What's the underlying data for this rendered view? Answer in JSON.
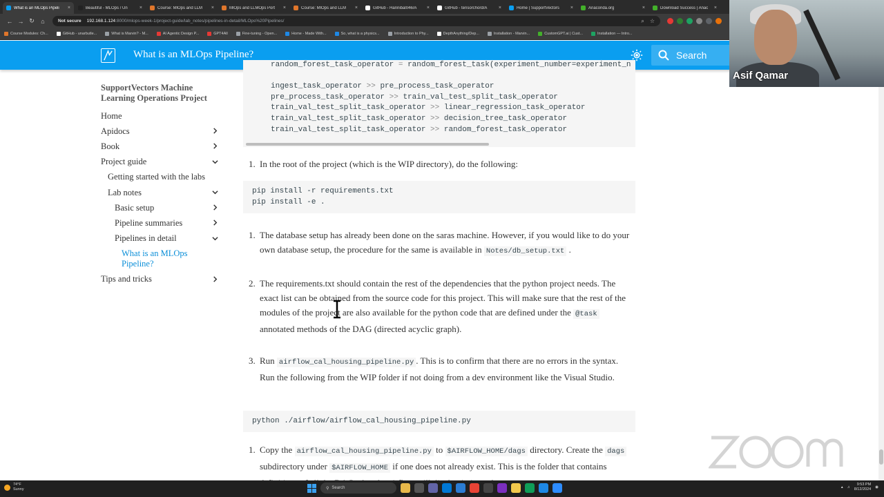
{
  "browser": {
    "tabs": [
      {
        "label": "What is an MLOps Pipeli",
        "color": "#0a9ef0",
        "active": true
      },
      {
        "label": "Beautiful - MLOps / Un",
        "color": "#222222"
      },
      {
        "label": "Course: MlOps and LLM",
        "color": "#e0762b"
      },
      {
        "label": "MlOps and LLMOps Port",
        "color": "#e0762b"
      },
      {
        "label": "Course: MlOps and LLM",
        "color": "#e0762b"
      },
      {
        "label": "GitHub - Hannibal046/A",
        "color": "#ffffff"
      },
      {
        "label": "GitHub - tensorchord/A",
        "color": "#ffffff"
      },
      {
        "label": "Home | SupportVectors",
        "color": "#0a9ef0"
      },
      {
        "label": "Anaconda.org",
        "color": "#43b02a"
      },
      {
        "label": "Download Success | Anac",
        "color": "#43b02a"
      }
    ],
    "security": "Not secure",
    "url_host": "192.168.1.124",
    "url_path": ":8000/mlops-week-1/project-guide/lab_notes/pipelines-in-detail/MLOps%20Pipelines/",
    "bookmarks": [
      "Course Modules: Ch...",
      "GitHub - unarbutle...",
      "What is Marvin? - M...",
      "AI Agentic Design P...",
      "GPT4All",
      "Fine-tuning - Open...",
      "Home - Made With...",
      "So, what is a physics...",
      "Introduction to Phy...",
      "DepthAnything/Dep...",
      "Installation - Marvin...",
      "CustomGPT.ai | Cust...",
      "Installation — Intro..."
    ]
  },
  "header": {
    "title": "What is an MLOps Pipeline?",
    "search_placeholder": "Search"
  },
  "sidebar": {
    "title": "SupportVectors Machine Learning Operations Project",
    "items": [
      {
        "label": "Home",
        "level": 0,
        "chevron": "none"
      },
      {
        "label": "Apidocs",
        "level": 0,
        "chevron": "right"
      },
      {
        "label": "Book",
        "level": 0,
        "chevron": "right"
      },
      {
        "label": "Project guide",
        "level": 0,
        "chevron": "down"
      },
      {
        "label": "Getting started with the labs",
        "level": 1,
        "chevron": "none"
      },
      {
        "label": "Lab notes",
        "level": 1,
        "chevron": "down"
      },
      {
        "label": "Basic setup",
        "level": 2,
        "chevron": "right"
      },
      {
        "label": "Pipeline summaries",
        "level": 2,
        "chevron": "right"
      },
      {
        "label": "Pipelines in detail",
        "level": 2,
        "chevron": "down"
      },
      {
        "label": "What is an MLOps Pipeline?",
        "level": 3,
        "chevron": "none"
      },
      {
        "label": "Tips and tricks",
        "level": 0,
        "chevron": "right"
      }
    ]
  },
  "content": {
    "code1_lines": [
      {
        "a": "random_forest_task_operator",
        "op": "=",
        "b": "random_forest_task(experiment_number=experiment_n"
      },
      {
        "a": "",
        "op": "",
        "b": ""
      },
      {
        "a": "ingest_task_operator",
        "op": ">>",
        "b": "pre_process_task_operator"
      },
      {
        "a": "pre_process_task_operator",
        "op": ">>",
        "b": "train_val_test_split_task_operator"
      },
      {
        "a": "train_val_test_split_task_operator",
        "op": ">>",
        "b": "linear_regression_task_operator"
      },
      {
        "a": "train_val_test_split_task_operator",
        "op": ">>",
        "b": "decision_tree_task_operator"
      },
      {
        "a": "train_val_test_split_task_operator",
        "op": ">>",
        "b": "random_forest_task_operator"
      }
    ],
    "step1": "In the root of the project (which is the WIP directory), do the following:",
    "code2_line1": "pip install -r requirements.txt",
    "code2_line2": "pip install -e .",
    "db_text": "The database setup has already been done on the saras machine. However, if you would like to do your own database setup, the procedure for the same is available in",
    "db_code": "Notes/db_setup.txt",
    "req_text1": "The requirements.txt should contain the rest of the dependencies that the python project needs. The exact list can be obtained from the source code for this project. This will make sure that the rest of the modules of the project are also available for the python code that are defined under the",
    "req_code": "@task",
    "req_text2": "annotated methods of the DAG (directed acyclic graph).",
    "run_prefix": "Run",
    "run_code": "airflow_cal_housing_pipeline.py",
    "run_text": ". This is to confirm that there are no errors in the syntax. Run the following from the WIP folder if not doing from a dev environment like the Visual Studio.",
    "code3": "python ./airflow/airflow_cal_housing_pipeline.py",
    "copy_prefix": "Copy the",
    "copy_code1": "airflow_cal_housing_pipeline.py",
    "copy_to": "to",
    "copy_code2": "$AIRFLOW_HOME/dags",
    "copy_text1": "directory. Create the",
    "copy_code3": "dags",
    "copy_text2": "subdirectory under",
    "copy_code4": "$AIRFLOW_HOME",
    "copy_text3": "if one does not already exist. This is the folder that contains definitions of all the DAGs that the airflow will display in its web-",
    "n1": "1.",
    "n2": "2.",
    "n3": "3."
  },
  "webcam": {
    "name": "Asif Qamar"
  },
  "taskbar": {
    "weather_temp": "74°F",
    "weather_desc": "Sunny",
    "search": "Search",
    "time": "9:53 PM",
    "date": "8/12/2024"
  },
  "colors": {
    "header": "#0a9ef0",
    "link": "#0a8ed8"
  }
}
